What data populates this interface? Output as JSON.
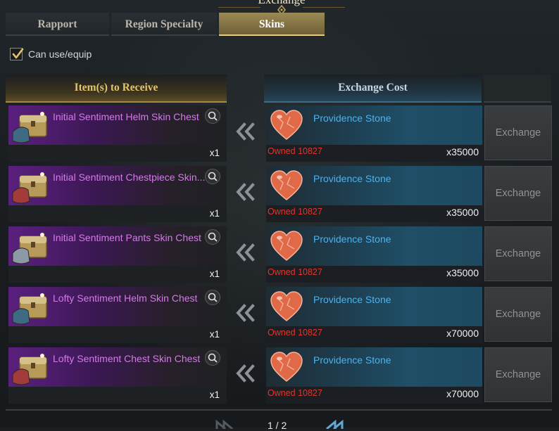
{
  "window": {
    "title": "Exchange"
  },
  "tabs": [
    {
      "label": "Rapport",
      "active": false
    },
    {
      "label": "Region Specialty",
      "active": false
    },
    {
      "label": "Skins",
      "active": true
    }
  ],
  "filter": {
    "checked": true,
    "label": "Can use/equip"
  },
  "headers": {
    "receive": "Item(s) to Receive",
    "cost": "Exchange Cost"
  },
  "rows": [
    {
      "item": "Initial Sentiment Helm Skin Chest",
      "item_icon": "helm-skin-chest-icon",
      "item_qty": "x1",
      "cost_item": "Providence Stone",
      "owned": "Owned 10827",
      "cost_qty": "x35000",
      "button": "Exchange"
    },
    {
      "item": "Initial Sentiment Chestpiece Skin...",
      "item_icon": "chestpiece-skin-chest-icon",
      "item_qty": "x1",
      "cost_item": "Providence Stone",
      "owned": "Owned 10827",
      "cost_qty": "x35000",
      "button": "Exchange"
    },
    {
      "item": "Initial Sentiment Pants Skin Chest",
      "item_icon": "pants-skin-chest-icon",
      "item_qty": "x1",
      "cost_item": "Providence Stone",
      "owned": "Owned 10827",
      "cost_qty": "x35000",
      "button": "Exchange"
    },
    {
      "item": "Lofty Sentiment Helm Skin Chest",
      "item_icon": "helm-skin-chest-icon",
      "item_qty": "x1",
      "cost_item": "Providence Stone",
      "owned": "Owned 10827",
      "cost_qty": "x70000",
      "button": "Exchange"
    },
    {
      "item": "Lofty Sentiment Chest Skin Chest",
      "item_icon": "chest-skin-chest-icon",
      "item_qty": "x1",
      "cost_item": "Providence Stone",
      "owned": "Owned 10827",
      "cost_qty": "x70000",
      "button": "Exchange"
    }
  ],
  "pagination": {
    "text": "1 / 2"
  },
  "colors": {
    "item_name": "#d27be6",
    "cost_name": "#4fb1ec",
    "owned": "#e0362c",
    "active_tab_border": "#e7cc7a",
    "receive_header": "#e3c46c"
  }
}
